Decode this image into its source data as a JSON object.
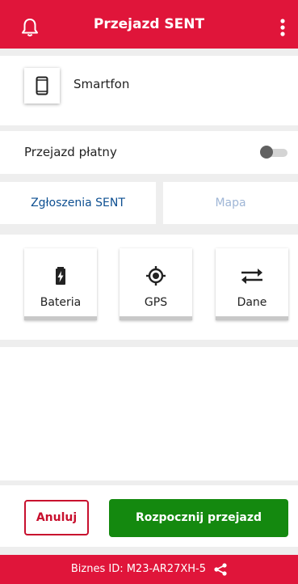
{
  "header": {
    "title": "Przejazd SENT",
    "bell_icon": "bell-icon",
    "menu_icon": "more-vertical-icon",
    "color": "#e0153a"
  },
  "device": {
    "icon": "smartphone-icon",
    "label": "Smartfon"
  },
  "toll": {
    "label": "Przejazd płatny",
    "enabled": false
  },
  "tabs": [
    {
      "label": "Zgłoszenia SENT",
      "active": true
    },
    {
      "label": "Mapa",
      "active": false
    }
  ],
  "status_tiles": [
    {
      "label": "Bateria",
      "icon": "battery-charging-icon"
    },
    {
      "label": "GPS",
      "icon": "gps-target-icon"
    },
    {
      "label": "Dane",
      "icon": "swap-arrows-icon"
    }
  ],
  "actions": {
    "cancel_label": "Anuluj",
    "start_label": "Rozpocznij przejazd",
    "cancel_color": "#c8102e",
    "start_color": "#14890f"
  },
  "footer": {
    "business_id": "Biznes ID:  M23-AR27XH-5",
    "share_icon": "share-icon"
  }
}
